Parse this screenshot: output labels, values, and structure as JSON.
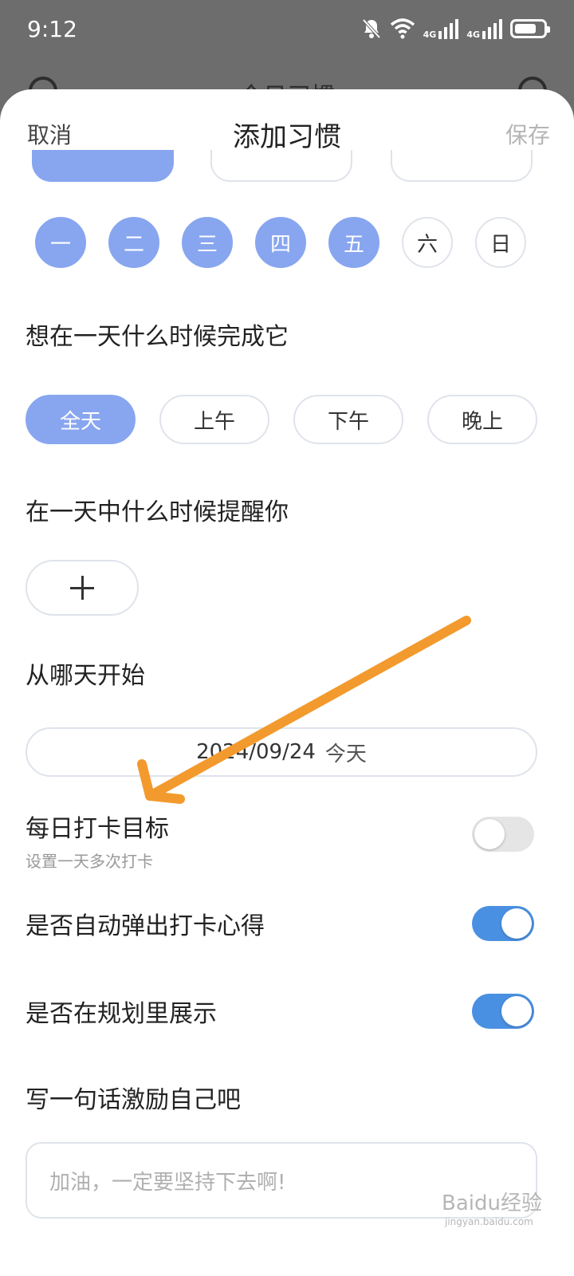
{
  "status_bar": {
    "time": "9:12",
    "network_label_1": "4G",
    "network_label_2": "4G"
  },
  "background_header": {
    "title": "今日习惯"
  },
  "sheet": {
    "cancel_label": "取消",
    "title": "添加习惯",
    "save_label": "保存",
    "weekdays": [
      {
        "label": "一",
        "selected": true
      },
      {
        "label": "二",
        "selected": true
      },
      {
        "label": "三",
        "selected": true
      },
      {
        "label": "四",
        "selected": true
      },
      {
        "label": "五",
        "selected": true
      },
      {
        "label": "六",
        "selected": false
      },
      {
        "label": "日",
        "selected": false
      }
    ],
    "time_of_day_label": "想在一天什么时候完成它",
    "time_of_day_options": [
      {
        "label": "全天",
        "selected": true
      },
      {
        "label": "上午",
        "selected": false
      },
      {
        "label": "下午",
        "selected": false
      },
      {
        "label": "晚上",
        "selected": false
      }
    ],
    "reminder_label": "在一天中什么时候提醒你",
    "start_label": "从哪天开始",
    "start_date": "2024/09/24",
    "start_date_today": "今天",
    "daily_goal": {
      "title": "每日打卡目标",
      "subtitle": "设置一天多次打卡",
      "enabled": false
    },
    "auto_popup": {
      "title": "是否自动弹出打卡心得",
      "enabled": true
    },
    "show_in_plan": {
      "title": "是否在规划里展示",
      "enabled": true
    },
    "motto_label": "写一句话激励自己吧",
    "motto_placeholder": "加油，一定要坚持下去啊!"
  },
  "watermark": {
    "text": "Baidu经验",
    "sub": "jingyan.baidu.com"
  },
  "colors": {
    "accent": "#88a6ef",
    "toggle_on": "#4a90e2",
    "annotation": "#f29a2e"
  }
}
